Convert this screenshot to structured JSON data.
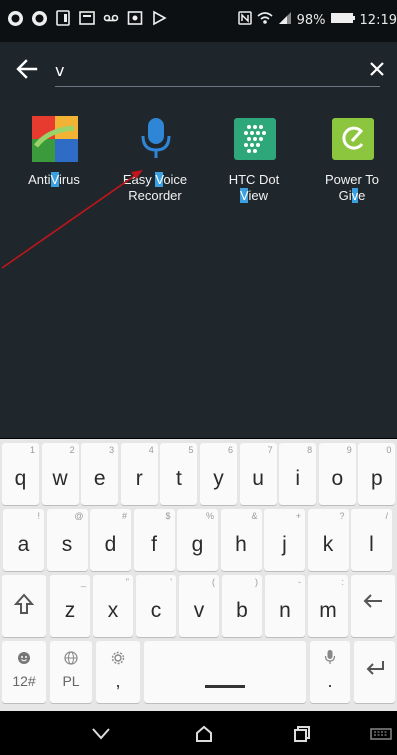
{
  "status_bar": {
    "battery": "98%",
    "time": "12:19",
    "icons": [
      "whatsapp-icon",
      "whatsapp-icon",
      "tablet-icon",
      "email-icon",
      "voicemail-icon",
      "cast-icon",
      "play-icon",
      "nfc-icon",
      "wifi-icon",
      "signal-icon",
      "battery-icon"
    ]
  },
  "search": {
    "query": "v",
    "back_icon": "arrow-left-icon",
    "clear_icon": "close-icon"
  },
  "results": [
    {
      "label_parts": [
        "Anti",
        "V",
        "irus"
      ],
      "label_line2": [
        "",
        "",
        ""
      ],
      "icon": "avg-antivirus-icon"
    },
    {
      "label_parts": [
        "Easy ",
        "V",
        "oice"
      ],
      "label_line2": [
        "Recorder",
        "",
        ""
      ],
      "icon": "microphone-icon"
    },
    {
      "label_parts": [
        "HTC Dot",
        "",
        ""
      ],
      "label_line2": [
        "",
        "V",
        "iew"
      ],
      "icon": "htc-dot-view-icon"
    },
    {
      "label_parts": [
        "Power To",
        "",
        ""
      ],
      "label_line2": [
        "Gi",
        "v",
        "e"
      ],
      "icon": "power-to-give-icon"
    }
  ],
  "keyboard": {
    "row1": [
      {
        "k": "q",
        "h": "1"
      },
      {
        "k": "w",
        "h": "2"
      },
      {
        "k": "e",
        "h": "3"
      },
      {
        "k": "r",
        "h": "4"
      },
      {
        "k": "t",
        "h": "5"
      },
      {
        "k": "y",
        "h": "6"
      },
      {
        "k": "u",
        "h": "7"
      },
      {
        "k": "i",
        "h": "8"
      },
      {
        "k": "o",
        "h": "9"
      },
      {
        "k": "p",
        "h": "0"
      }
    ],
    "row2": [
      {
        "k": "a",
        "h": "!"
      },
      {
        "k": "s",
        "h": "@"
      },
      {
        "k": "d",
        "h": "#"
      },
      {
        "k": "f",
        "h": "$"
      },
      {
        "k": "g",
        "h": "%"
      },
      {
        "k": "h",
        "h": "&"
      },
      {
        "k": "j",
        "h": "+"
      },
      {
        "k": "k",
        "h": "?"
      },
      {
        "k": "l",
        "h": "/"
      }
    ],
    "row3": [
      {
        "k": "z",
        "h": "_"
      },
      {
        "k": "x",
        "h": "\""
      },
      {
        "k": "c",
        "h": "'"
      },
      {
        "k": "v",
        "h": "("
      },
      {
        "k": "b",
        "h": ")"
      },
      {
        "k": "n",
        "h": "-"
      },
      {
        "k": "m",
        "h": ":"
      }
    ],
    "symbols_label": "12#",
    "language_label": "PL",
    "comma_label": ",",
    "period_label": ".",
    "shift_icon": "shift-icon",
    "backspace_icon": "backspace-icon",
    "emoji_icon": "emoji-icon",
    "globe_icon": "globe-icon",
    "settings_icon": "settings-gear-icon",
    "mic_icon": "microphone-icon",
    "enter_icon": "enter-icon"
  },
  "nav_bar": {
    "back_icon": "chevron-down-icon",
    "home_icon": "home-icon",
    "recents_icon": "recents-icon",
    "keyboard_icon": "keyboard-icon"
  },
  "colors": {
    "highlight": "#3aa0e0",
    "background": "#1f262c",
    "annotation": "#c0151a"
  }
}
